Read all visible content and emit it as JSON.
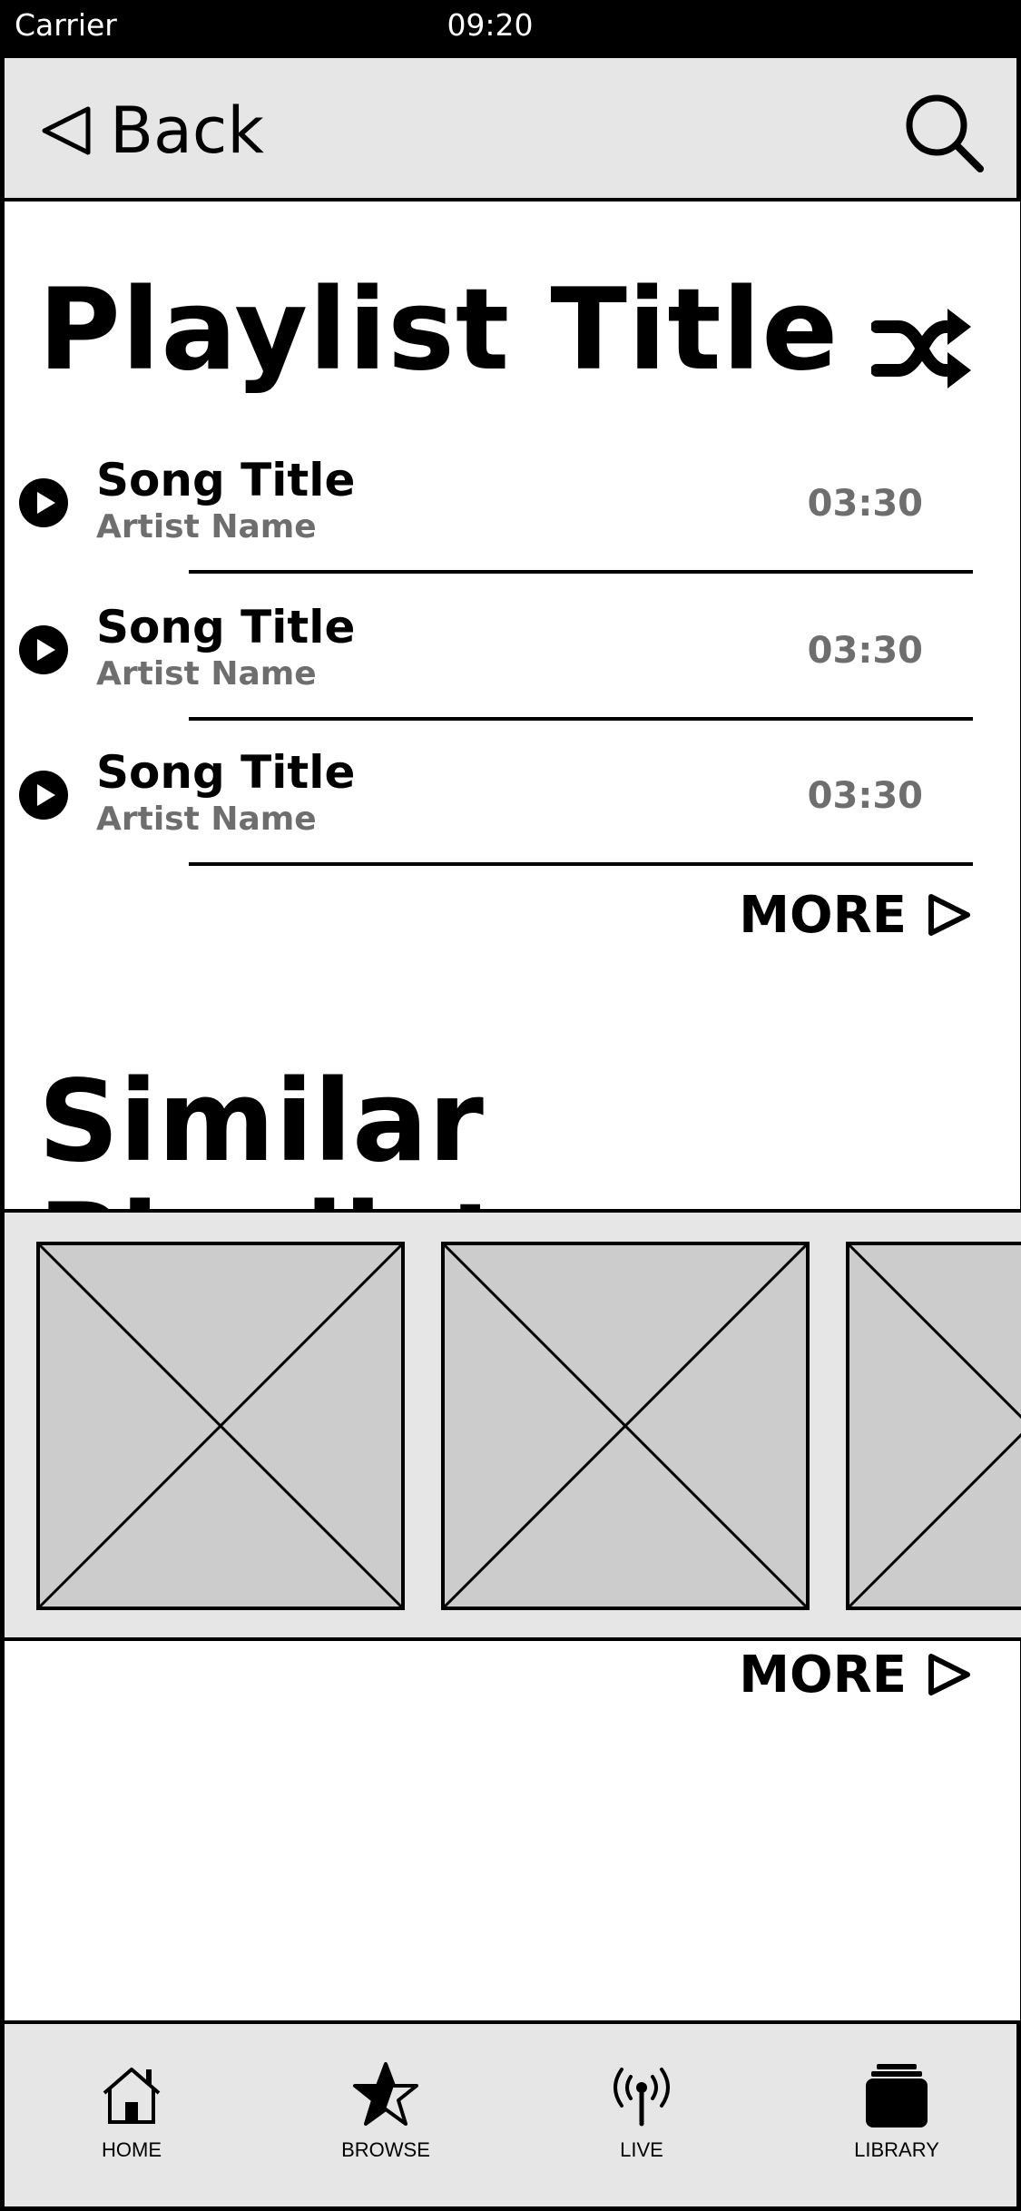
{
  "status_bar": {
    "carrier": "Carrier",
    "time": "09:20"
  },
  "nav": {
    "back_label": "Back",
    "back_icon": "back-triangle-icon",
    "search_icon": "search-icon"
  },
  "playlist": {
    "title": "Playlist Title",
    "shuffle_icon": "shuffle-icon",
    "songs": [
      {
        "title": "Song Title",
        "artist": "Artist Name",
        "duration": "03:30"
      },
      {
        "title": "Song Title",
        "artist": "Artist Name",
        "duration": "03:30"
      },
      {
        "title": "Song Title",
        "artist": "Artist Name",
        "duration": "03:30"
      }
    ],
    "more_label": "MORE"
  },
  "similar": {
    "title": "Similar Playlists",
    "thumbnails": [
      "image-placeholder",
      "image-placeholder",
      "image-placeholder"
    ],
    "more_label": "MORE"
  },
  "tab_bar": {
    "tabs": [
      {
        "label": "HOME",
        "icon": "home-icon"
      },
      {
        "label": "BROWSE",
        "icon": "star-icon"
      },
      {
        "label": "LIVE",
        "icon": "broadcast-icon"
      },
      {
        "label": "LIBRARY",
        "icon": "library-icon"
      }
    ]
  },
  "colors": {
    "chrome_bg": "#e6e6e6",
    "placeholder_bg": "#cccccc",
    "muted_text": "#6e6e6e",
    "status_bg": "#000000"
  }
}
